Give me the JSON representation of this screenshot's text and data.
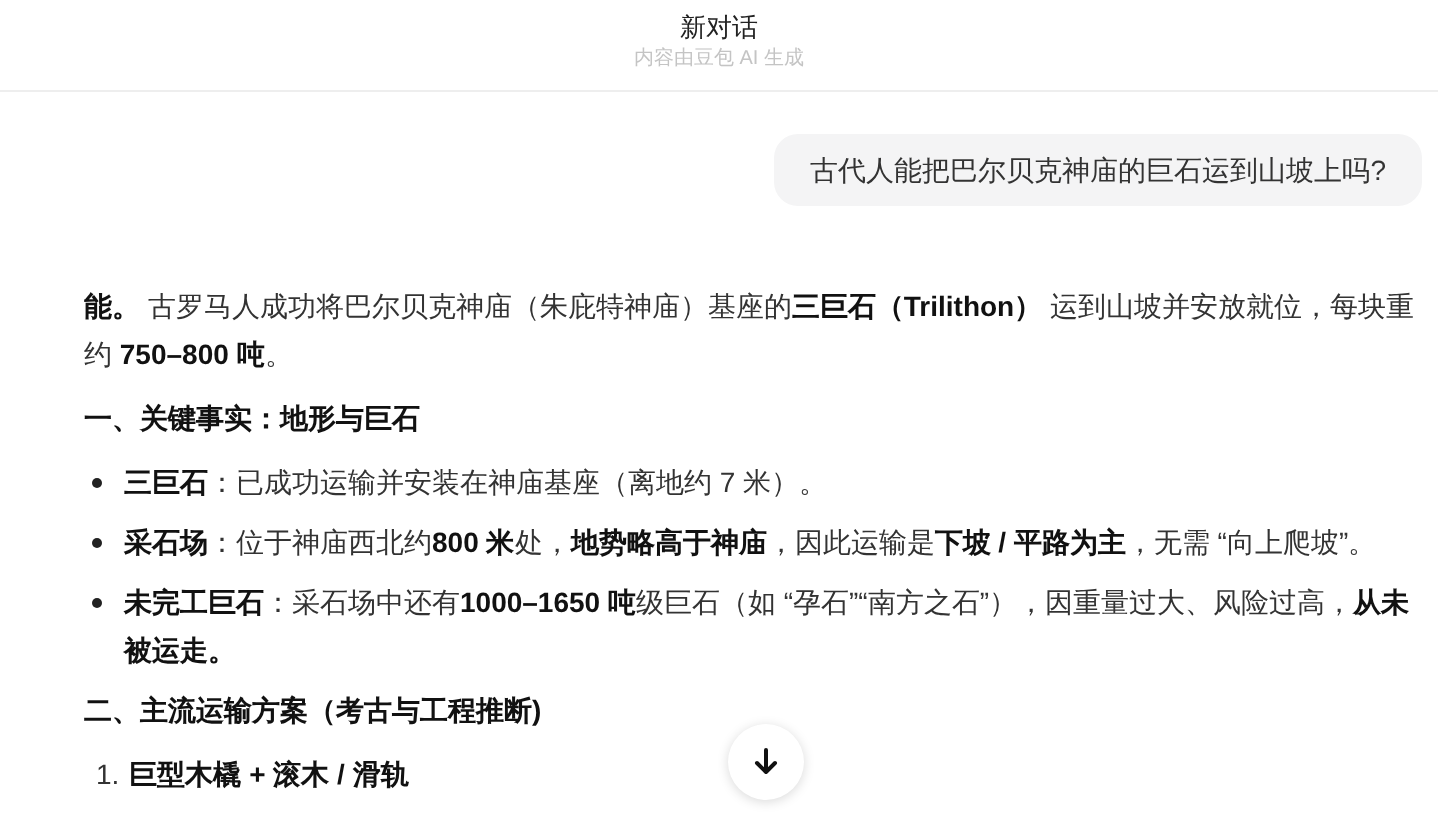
{
  "header": {
    "title": "新对话",
    "subtitle": "内容由豆包 AI 生成"
  },
  "user_message": "古代人能把巴尔贝克神庙的巨石运到山坡上吗?",
  "answer": [
    {
      "kind": "paragraph",
      "text": "**能。** 古罗马人成功将巴尔贝克神庙（朱庇特神庙）基座的**三巨石（Trilithon）** 运到山坡并安放就位，每块重约 **750–800 吨**。"
    },
    {
      "kind": "heading",
      "text": "一、关键事实：地形与巨石"
    },
    {
      "kind": "bullet",
      "text": "**三巨石**：已成功运输并安装在神庙基座（离地约 7 米）。"
    },
    {
      "kind": "bullet",
      "text": "**采石场**：位于神庙西北约**800 米**处，**地势略高于神庙**，因此运输是**下坡 / 平路为主**，无需 “向上爬坡”。"
    },
    {
      "kind": "bullet",
      "text": "**未完工巨石**：采石场中还有**1000–1650 吨**级巨石（如 “孕石”“南方之石”），因重量过大、风险过高，**从未被运走。**"
    },
    {
      "kind": "heading",
      "text": "二、主流运输方案（考古与工程推断)"
    },
    {
      "kind": "numbered",
      "number": "1.",
      "text": "巨型木橇 + 滚木 / 滑轨"
    }
  ]
}
